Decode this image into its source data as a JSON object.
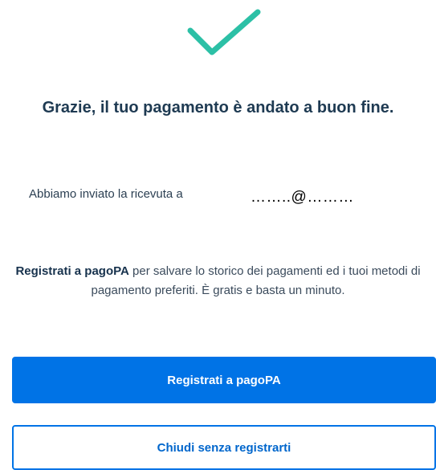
{
  "success_icon": {
    "name": "checkmark-icon",
    "color": "#2cc0a6"
  },
  "title": "Grazie, il tuo pagamento è andato a buon fine.",
  "receipt": {
    "label": "Abbiamo inviato la ricevuta a",
    "email": "……..@………"
  },
  "info": {
    "link_text": "Registrati a pagoPA",
    "text": " per salvare lo storico dei pagamenti ed i tuoi metodi di pagamento preferiti. È gratis e basta un minuto."
  },
  "buttons": {
    "register_label": "Registrati a pagoPA",
    "close_label": "Chiudi senza registrarti"
  },
  "colors": {
    "primary": "#0073e6",
    "title": "#1e3a52"
  }
}
